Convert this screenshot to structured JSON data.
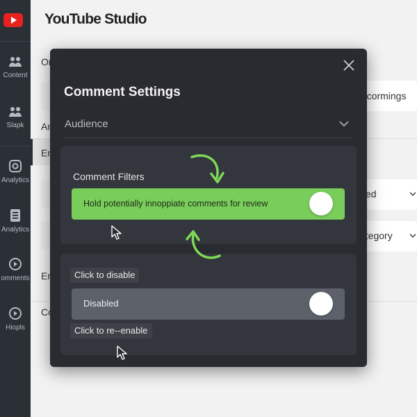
{
  "app": {
    "title": "YouTube Studio"
  },
  "sidebar": {
    "items": [
      {
        "label": "Content",
        "icon": "people-icon"
      },
      {
        "label": "Slapk",
        "icon": "people-icon"
      },
      {
        "label": "Analytics",
        "icon": "camera-icon"
      },
      {
        "label": "Analytics",
        "icon": "document-icon"
      },
      {
        "label": "omments",
        "icon": "play-circle-icon"
      },
      {
        "label": "Hiopls",
        "icon": "play-circle-icon"
      }
    ]
  },
  "background": {
    "frag_or": "Or",
    "frag_an": "An",
    "frag_en1": "En",
    "frag_en2": "En",
    "frag_co": "Co",
    "right_comments": "e cormings",
    "right_ed": "ed",
    "right_category": "ategory"
  },
  "modal": {
    "title": "Comment Settings",
    "dropdown_value": "Audience",
    "filters": {
      "heading": "Comment Filters",
      "toggle_label": "Hold potentially innoppiate comments for review",
      "toggle_state": "on"
    },
    "second": {
      "tooltip_disable": "Click to disable",
      "toggle_label": "Disabled",
      "toggle_state": "off",
      "tooltip_enable": "Click to re--enable"
    }
  },
  "colors": {
    "brand_red": "#e8231f",
    "toggle_on": "#79cd5b",
    "toggle_off": "#5d616a",
    "modal_bg": "#292b30",
    "sidebar_bg": "#2b2f36",
    "annotation_arrow": "#7ed957"
  }
}
